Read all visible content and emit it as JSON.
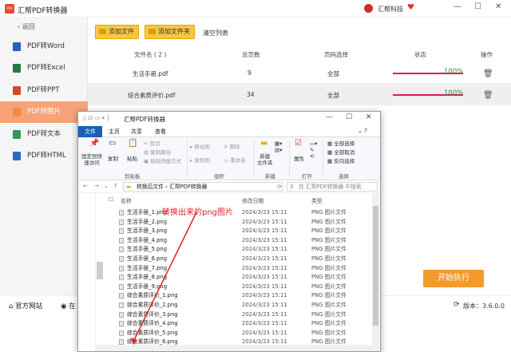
{
  "app": {
    "logo": "PDF",
    "title": "汇帮PDF转换器",
    "brand": "汇帮科技",
    "min": "—",
    "max": "☐",
    "close": "✕"
  },
  "sidebar": {
    "back": "返回",
    "items": [
      "PDF转Word",
      "PDF转Excel",
      "PDF转PPT",
      "PDF转图片",
      "PDF转文本",
      "PDF转HTML"
    ],
    "icon_colors": [
      "#2b5fbd",
      "#1e7b45",
      "#d04a2b",
      "#f08a3c",
      "#2f9a5b",
      "#2b6cc4"
    ]
  },
  "toolbar": {
    "add_file": "添加文件",
    "add_folder": "添加文件夹",
    "clear": "清空列表"
  },
  "table": {
    "headers": [
      "文件名 ( 2 )",
      "总页数",
      "页码选择",
      "状态",
      "操作"
    ],
    "rows": [
      {
        "name": "生活手册.pdf",
        "pages": "9",
        "range": "全部",
        "progress": 1.0,
        "pct": "100%"
      },
      {
        "name": "综合素质评价.pdf",
        "pages": "34",
        "range": "全部",
        "progress": 1.0,
        "pct": "100%"
      }
    ]
  },
  "run": "开始执行",
  "bottom": {
    "site": "官方网站",
    "other": "在",
    "version": "版本：3.6.0.0"
  },
  "explorer": {
    "title": "汇帮PDF转换器",
    "tabs": [
      "文件",
      "主页",
      "共享",
      "查看"
    ],
    "ribbon": {
      "pin": "固定到快\n速访问",
      "copy": "复制",
      "paste": "粘贴",
      "cut": "剪切",
      "copy_path": "复制路径",
      "paste_shortcut": "粘贴快捷方式",
      "move_to": "移动到",
      "copy_to": "复制到",
      "delete": "删除",
      "rename": "重命名",
      "new_folder": "新建\n文件夹",
      "props": "属性",
      "select_all": "全部选择",
      "select_none": "全部取消",
      "invert": "反向选择",
      "g_clipboard": "剪贴板",
      "g_organize": "组织",
      "g_new": "新建",
      "g_open": "打开",
      "g_select": "选择"
    },
    "path": [
      "转换后文件",
      "汇帮PDF转换器"
    ],
    "search": "在 汇帮PDF转换器 中搜索",
    "headers": {
      "name": "名称",
      "date": "修改日期",
      "type": "类型"
    },
    "files": [
      {
        "name": "生活手册_1.png",
        "date": "2024/3/23 15:11",
        "type": "PNG 图片文件"
      },
      {
        "name": "生活手册_2.png",
        "date": "2024/3/23 15:11",
        "type": "PNG 图片文件"
      },
      {
        "name": "生活手册_3.png",
        "date": "2024/3/23 15:11",
        "type": "PNG 图片文件"
      },
      {
        "name": "生活手册_4.png",
        "date": "2024/3/23 15:11",
        "type": "PNG 图片文件"
      },
      {
        "name": "生活手册_5.png",
        "date": "2024/3/23 15:11",
        "type": "PNG 图片文件"
      },
      {
        "name": "生活手册_6.png",
        "date": "2024/3/23 15:11",
        "type": "PNG 图片文件"
      },
      {
        "name": "生活手册_7.png",
        "date": "2024/3/23 15:11",
        "type": "PNG 图片文件"
      },
      {
        "name": "生活手册_8.png",
        "date": "2024/3/23 15:11",
        "type": "PNG 图片文件"
      },
      {
        "name": "生活手册_9.png",
        "date": "2024/3/23 15:11",
        "type": "PNG 图片文件"
      },
      {
        "name": "综合素质评价_1.png",
        "date": "2024/3/23 15:11",
        "type": "PNG 图片文件"
      },
      {
        "name": "综合素质评价_2.png",
        "date": "2024/3/23 15:11",
        "type": "PNG 图片文件"
      },
      {
        "name": "综合素质评价_3.png",
        "date": "2024/3/23 15:11",
        "type": "PNG 图片文件"
      },
      {
        "name": "综合素质评价_4.png",
        "date": "2024/3/23 15:11",
        "type": "PNG 图片文件"
      },
      {
        "name": "综合素质评价_5.png",
        "date": "2024/3/23 15:11",
        "type": "PNG 图片文件"
      },
      {
        "name": "综合素质评价_6.png",
        "date": "2024/3/23 15:11",
        "type": "PNG 图片文件"
      }
    ]
  },
  "annotation": "转换出来的png图片",
  "colors": {
    "accent": "#f39a2a",
    "progress": "#e1195a",
    "annot": "#e0222a"
  }
}
